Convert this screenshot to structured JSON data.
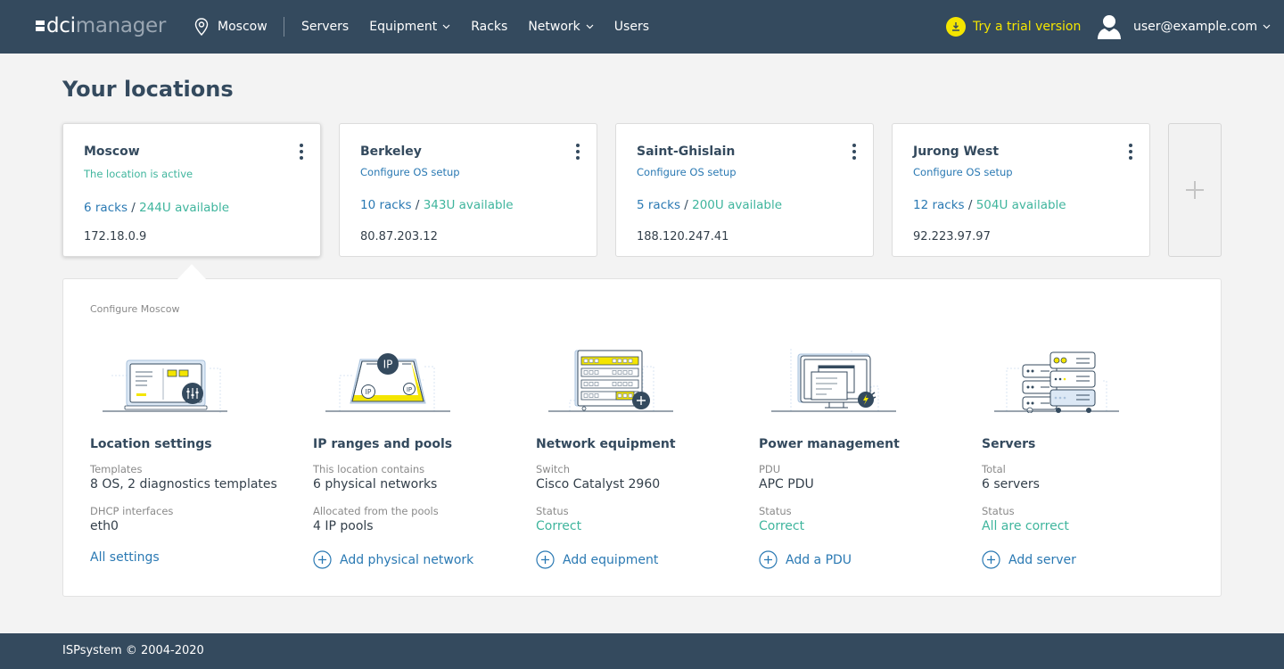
{
  "header": {
    "logo": {
      "part1": "dci",
      "part2": "manager"
    },
    "location": {
      "icon": "map-pin-icon",
      "label": "Moscow"
    },
    "nav": [
      {
        "label": "Servers",
        "dropdown": false
      },
      {
        "label": "Equipment",
        "dropdown": true
      },
      {
        "label": "Racks",
        "dropdown": false
      },
      {
        "label": "Network",
        "dropdown": true
      },
      {
        "label": "Users",
        "dropdown": false
      }
    ],
    "trial": {
      "icon": "download-icon",
      "label": "Try a trial version"
    },
    "user": {
      "icon": "user-icon",
      "email": "user@example.com"
    }
  },
  "page": {
    "title": "Your locations"
  },
  "locations": [
    {
      "name": "Moscow",
      "status": "The location is active",
      "status_type": "active",
      "racks": "6 racks",
      "sep": " / ",
      "available": "244U available",
      "ip": "172.18.0.9",
      "selected": true
    },
    {
      "name": "Berkeley",
      "status": "Configure OS setup",
      "status_type": "configure",
      "racks": "10 racks",
      "sep": " / ",
      "available": "343U available",
      "ip": "80.87.203.12",
      "selected": false
    },
    {
      "name": "Saint-Ghislain",
      "status": "Configure OS setup",
      "status_type": "configure",
      "racks": "5 racks",
      "sep": " / ",
      "available": "200U available",
      "ip": "188.120.247.41",
      "selected": false
    },
    {
      "name": "Jurong West",
      "status": "Configure OS setup",
      "status_type": "configure",
      "racks": "12 racks",
      "sep": " / ",
      "available": "504U available",
      "ip": "92.223.97.97",
      "selected": false
    }
  ],
  "configure": {
    "title": "Configure Moscow",
    "sections": [
      {
        "title": "Location settings",
        "label1": "Templates",
        "value1": "8 OS, 2 diagnostics templates",
        "label2": "DHCP interfaces",
        "value2": "eth0",
        "action": "All settings",
        "action_has_icon": false
      },
      {
        "title": "IP ranges and pools",
        "label1": "This location contains",
        "value1": "6 physical networks",
        "label2": "Allocated from the pools",
        "value2": "4 IP pools",
        "action": "Add physical network",
        "action_has_icon": true
      },
      {
        "title": "Network equipment",
        "label1": "Switch",
        "value1": "Cisco Catalyst 2960",
        "label2": "Status",
        "value2": "Correct",
        "action": "Add equipment",
        "action_has_icon": true
      },
      {
        "title": "Power management",
        "label1": "PDU",
        "value1": "APC PDU",
        "label2": "Status",
        "value2": "Correct",
        "action": "Add a PDU",
        "action_has_icon": true
      },
      {
        "title": "Servers",
        "label1": "Total",
        "value1": "6 servers",
        "label2": "Status",
        "value2": "All are correct",
        "action": "Add server",
        "action_has_icon": true
      }
    ]
  },
  "illustration_text": {
    "ip": "IP"
  },
  "footer": {
    "copyright": "ISPsystem © 2004-2020"
  },
  "colors": {
    "header_bg": "#344a5e",
    "accent_blue": "#2a79b3",
    "accent_green": "#3fb59d",
    "trial_yellow": "#f4e500"
  }
}
